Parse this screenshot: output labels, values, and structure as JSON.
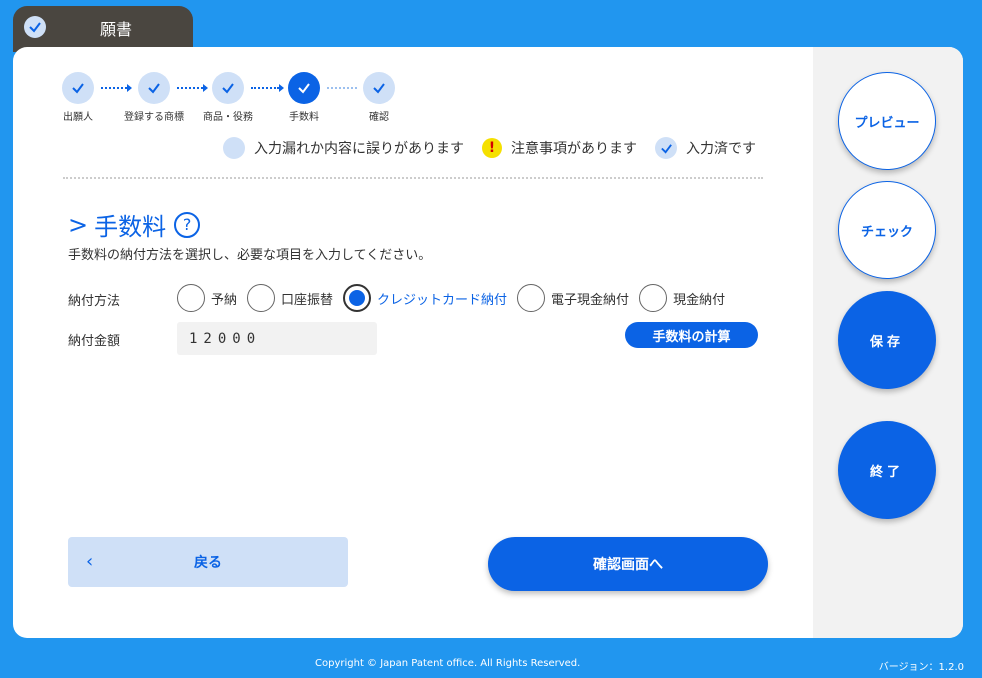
{
  "tab": {
    "title": "願書"
  },
  "stepper": {
    "steps": [
      {
        "label": "出願人",
        "state": "done"
      },
      {
        "label": "登録する商標",
        "state": "done"
      },
      {
        "label": "商品・役務",
        "state": "done"
      },
      {
        "label": "手数料",
        "state": "active"
      },
      {
        "label": "確認",
        "state": "done"
      }
    ]
  },
  "legend": {
    "error": "入力漏れか内容に誤りがあります",
    "warning": "注意事項があります",
    "done": "入力済です"
  },
  "section": {
    "title": "手数料",
    "prefix": ">",
    "help": "?",
    "description": "手数料の納付方法を選択し、必要な項目を入力してください。"
  },
  "payment": {
    "method_label": "納付方法",
    "options": [
      {
        "label": "予納",
        "selected": false
      },
      {
        "label": "口座振替",
        "selected": false
      },
      {
        "label": "クレジットカード納付",
        "selected": true
      },
      {
        "label": "電子現金納付",
        "selected": false
      },
      {
        "label": "現金納付",
        "selected": false
      }
    ],
    "amount_label": "納付金額",
    "amount_value": "12000",
    "calc_button": "手数料の計算"
  },
  "nav": {
    "back": "戻る",
    "back_icon": "‹",
    "confirm": "確認画面へ"
  },
  "sidebar": {
    "preview": "プレビュー",
    "check": "チェック",
    "save": "保存",
    "exit": "終了"
  },
  "footer": {
    "copyright": "Copyright © Japan Patent office. All Rights Reserved.",
    "version": "バージョン：1.2.0"
  },
  "colors": {
    "accent": "#0b63e5",
    "background": "#2196ef",
    "light": "#cfe0f7"
  }
}
